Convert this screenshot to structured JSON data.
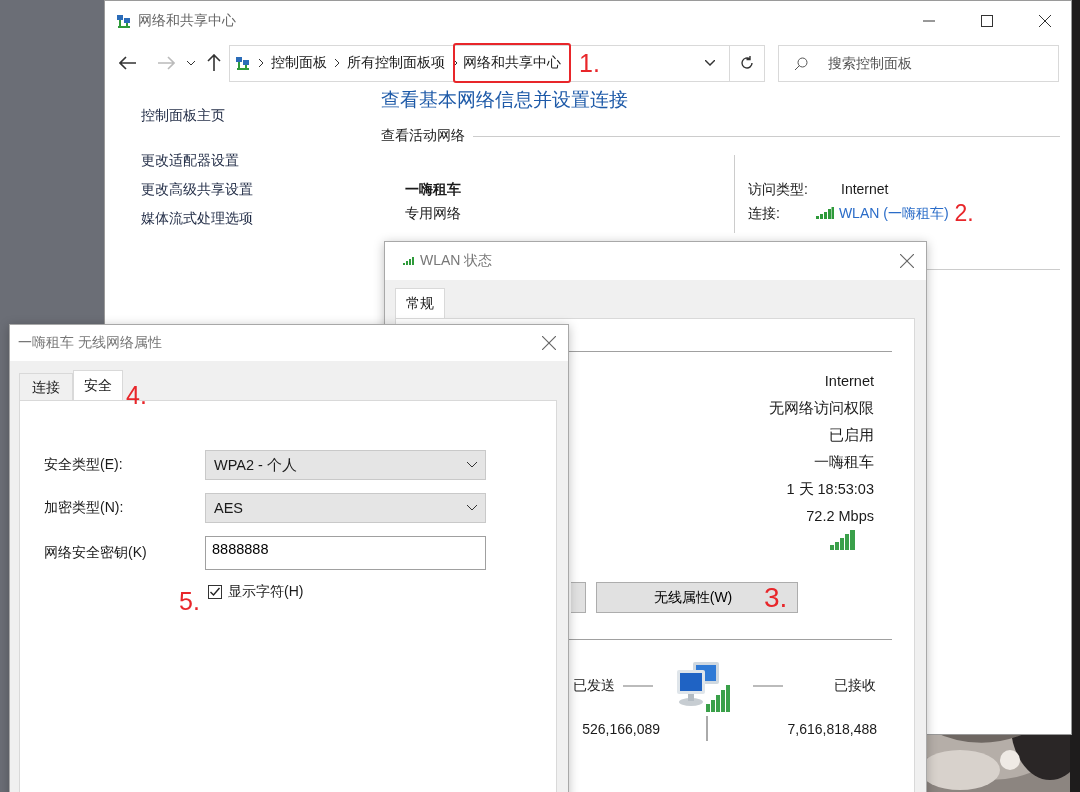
{
  "main_window": {
    "title": "网络和共享中心",
    "breadcrumb": [
      {
        "label": "控制面板",
        "highlighted": false
      },
      {
        "label": "所有控制面板项",
        "highlighted": false
      },
      {
        "label": "网络和共享中心",
        "highlighted": true,
        "annotation": "1."
      }
    ],
    "search": {
      "placeholder": "搜索控制面板"
    },
    "sidebar": {
      "items": [
        "控制面板主页",
        "更改适配器设置",
        "更改高级共享设置",
        "媒体流式处理选项"
      ]
    },
    "heading": "查看基本网络信息并设置连接",
    "section_title": "查看活动网络",
    "network": {
      "name": "一嗨租车",
      "category": "专用网络",
      "access_type_label": "访问类型:",
      "access_type": "Internet",
      "connection_label": "连接:",
      "connection": "WLAN (一嗨租车)",
      "connection_annotation": "2."
    }
  },
  "status_dialog": {
    "title": "WLAN 状态",
    "tabs": [
      {
        "label": "常规",
        "selected": true
      }
    ],
    "values": [
      "Internet",
      "无网络访问权限",
      "已启用",
      "一嗨租车",
      "1 天 18:53:03",
      "72.2 Mbps"
    ],
    "wireless_button": {
      "label": "无线属性(W)",
      "annotation": "3."
    },
    "activity": {
      "sent_label": "已发送",
      "received_label": "已接收",
      "sent": "526,166,089",
      "received": "7,616,818,488"
    }
  },
  "properties_dialog": {
    "title": "一嗨租车 无线网络属性",
    "tabs": [
      {
        "label": "连接",
        "selected": false
      },
      {
        "label": "安全",
        "selected": true,
        "annotation": "4."
      }
    ],
    "fields": [
      {
        "kind": "select",
        "label": "安全类型(E):",
        "value": "WPA2 - 个人"
      },
      {
        "kind": "select",
        "label": "加密类型(N):",
        "value": "AES"
      },
      {
        "kind": "text",
        "label": "网络安全密钥(K)",
        "value": "8888888"
      }
    ],
    "show_characters": {
      "label": "显示字符(H)",
      "checked": true,
      "annotation": "5."
    }
  }
}
